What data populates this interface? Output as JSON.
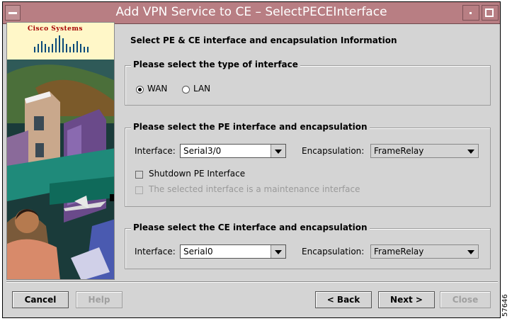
{
  "window": {
    "title": "Add VPN Service to CE – SelectPECEInterface"
  },
  "logo": {
    "text": "Cisco Systems"
  },
  "main": {
    "heading": "Select PE & CE interface and encapsulation Information"
  },
  "type_group": {
    "title": "Please select the type of interface",
    "options": [
      {
        "label": "WAN",
        "selected": true
      },
      {
        "label": "LAN",
        "selected": false
      }
    ]
  },
  "pe_group": {
    "title": "Please select the PE interface and encapsulation",
    "interface_label": "Interface:",
    "interface_value": "Serial3/0",
    "encapsulation_label": "Encapsulation:",
    "encapsulation_value": "FrameRelay",
    "shutdown_label": "Shutdown PE Interface",
    "maintenance_label": "The selected interface is a maintenance interface"
  },
  "ce_group": {
    "title": "Please select the CE interface and encapsulation",
    "interface_label": "Interface:",
    "interface_value": "Serial0",
    "encapsulation_label": "Encapsulation:",
    "encapsulation_value": "FrameRelay"
  },
  "buttons": {
    "cancel": "Cancel",
    "help": "Help",
    "back": "< Back",
    "next": "Next >",
    "close": "Close"
  },
  "figure_number": "57646"
}
